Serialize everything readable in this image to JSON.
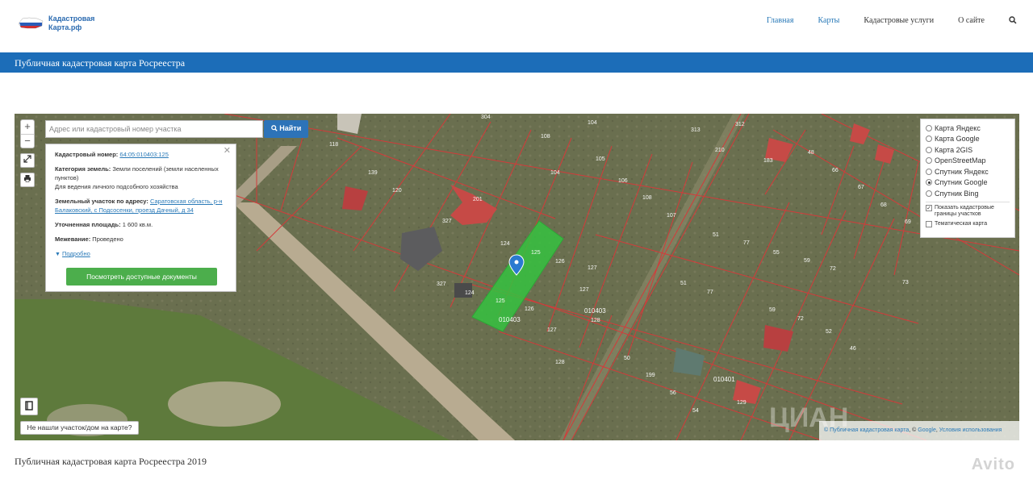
{
  "header": {
    "logo_text": "Кадастровая Карта.рф",
    "nav": [
      "Главная",
      "Карты",
      "Кадастровые услуги",
      "О сайте"
    ]
  },
  "page_banner": "Публичная кадастровая карта Росреестра",
  "map": {
    "zoom_in": "+",
    "zoom_out": "−",
    "search_placeholder": "Адрес или кадастровый номер участка",
    "search_button": "Найти",
    "not_found_button": "Не нашли участок/дом на карте?",
    "attribution": {
      "part1": "© Публичная кадастровая карта",
      "part2": ", © ",
      "part3": "Google",
      "part4": ", ",
      "part5": "Условия использования"
    },
    "watermark": "ЦИАН"
  },
  "info_panel": {
    "cadastral_label": "Кадастровый номер:",
    "cadastral_value": "64:05:010403:125",
    "category_label": "Категория земель:",
    "category_value": "Земли поселений (земли населенных пунктов)",
    "usage": "Для ведения личного подсобного хозяйства",
    "address_label": "Земельный участок по адресу:",
    "address_value": "Саратовская область, р-н Балаковский, с Подсосенки, проезд Дачный, д 34",
    "area_label": "Уточненная площадь:",
    "area_value": "1 600 кв.м.",
    "survey_label": "Межевание:",
    "survey_value": "Проведено",
    "more_link": "Подробно",
    "docs_button": "Посмотреть доступные документы"
  },
  "layers": {
    "options": [
      {
        "label": "Карта Яндекс",
        "selected": false
      },
      {
        "label": "Карта Google",
        "selected": false
      },
      {
        "label": "Карта 2GIS",
        "selected": false
      },
      {
        "label": "OpenStreetMap",
        "selected": false
      },
      {
        "label": "Спутник Яндекс",
        "selected": false
      },
      {
        "label": "Спутник Google",
        "selected": true
      },
      {
        "label": "Спутник Bing",
        "selected": false
      }
    ],
    "show_boundaries": "Показать кадастровые границы участков",
    "show_boundaries_checked": true,
    "thematic_map": "Тематическая карта",
    "thematic_checked": false
  },
  "parcel_labels": [
    "304",
    "108",
    "104",
    "313",
    "312",
    "118",
    "103",
    "105",
    "210",
    "139",
    "120",
    "104",
    "106",
    "108",
    "201",
    "107",
    "327",
    "124",
    "125",
    "126",
    "127",
    "51",
    "77",
    "55",
    "59",
    "72",
    "327",
    "124",
    "125",
    "126",
    "127",
    "010403",
    "128",
    "51",
    "77",
    "59",
    "72",
    "52",
    "128",
    "010403",
    "50",
    "199",
    "56",
    "55",
    "54",
    "010401",
    "129",
    "48",
    "66",
    "67",
    "68",
    "69",
    "73",
    "46",
    "63",
    "127"
  ],
  "footer": {
    "title": "Публичная кадастровая карта Росреестра 2019",
    "avito": "Avito"
  }
}
